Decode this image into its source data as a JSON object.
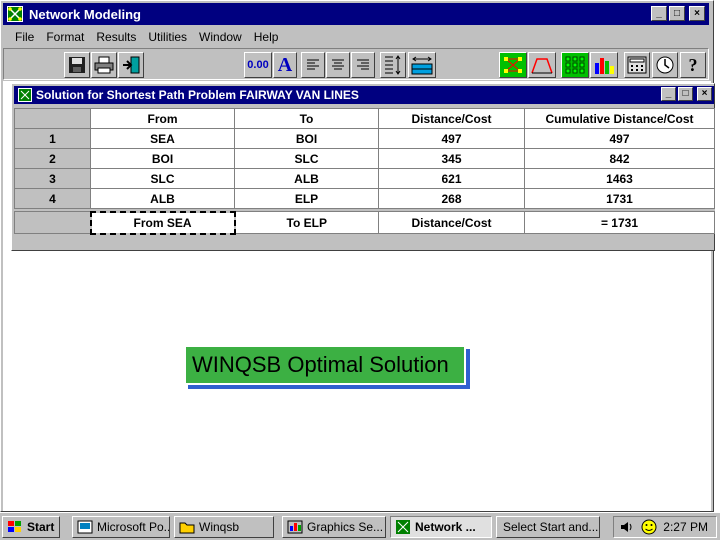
{
  "window": {
    "title": "Network Modeling",
    "controls": {
      "minimize": "_",
      "maximize": "□",
      "close": "×"
    }
  },
  "menu": [
    {
      "label": "File"
    },
    {
      "label": "Format"
    },
    {
      "label": "Results"
    },
    {
      "label": "Utilities"
    },
    {
      "label": "Window"
    },
    {
      "label": "Help"
    }
  ],
  "toolbar": {
    "decimal_label": "0.00",
    "font_label": "A",
    "icons": [
      "save-icon",
      "print-icon",
      "exit-icon",
      "decimal-icon",
      "font-icon",
      "align-left-icon",
      "align-center-icon",
      "align-right-icon",
      "row-height-icon",
      "column-width-icon",
      "network-graph-icon",
      "curve-graph-icon",
      "grid-icon",
      "bar-chart-icon",
      "calculator-icon",
      "clock-icon",
      "help-icon"
    ]
  },
  "solution": {
    "title": "Solution for Shortest Path Problem FAIRWAY VAN LINES",
    "columns": [
      "From",
      "To",
      "Distance/Cost",
      "Cumulative Distance/Cost"
    ],
    "rows": [
      {
        "num": "1",
        "from": "SEA",
        "to": "BOI",
        "distance": "497",
        "cumulative": "497"
      },
      {
        "num": "2",
        "from": "BOI",
        "to": "SLC",
        "distance": "345",
        "cumulative": "842"
      },
      {
        "num": "3",
        "from": "SLC",
        "to": "ALB",
        "distance": "621",
        "cumulative": "1463"
      },
      {
        "num": "4",
        "from": "ALB",
        "to": "ELP",
        "distance": "268",
        "cumulative": "1731"
      }
    ],
    "summary": {
      "from": "From SEA",
      "to": "To ELP",
      "label": "Distance/Cost",
      "total": "= 1731"
    }
  },
  "caption": "WINQSB Optimal Solution",
  "taskbar": {
    "start": "Start",
    "tasks": [
      {
        "label": "Microsoft Po...",
        "icon": "powerpoint-icon"
      },
      {
        "label": "Winqsb",
        "icon": "folder-icon"
      },
      {
        "label": "Graphics Se...",
        "icon": "graphics-icon"
      },
      {
        "label": "Network ...",
        "icon": "network-icon"
      },
      {
        "label": "Select Start and...",
        "icon": ""
      }
    ],
    "clock": "2:27 PM"
  },
  "colors": {
    "titlebar": "#000080",
    "face": "#c0c0c0",
    "caption_fill": "#3cb043",
    "caption_shadow": "#3060d0"
  }
}
